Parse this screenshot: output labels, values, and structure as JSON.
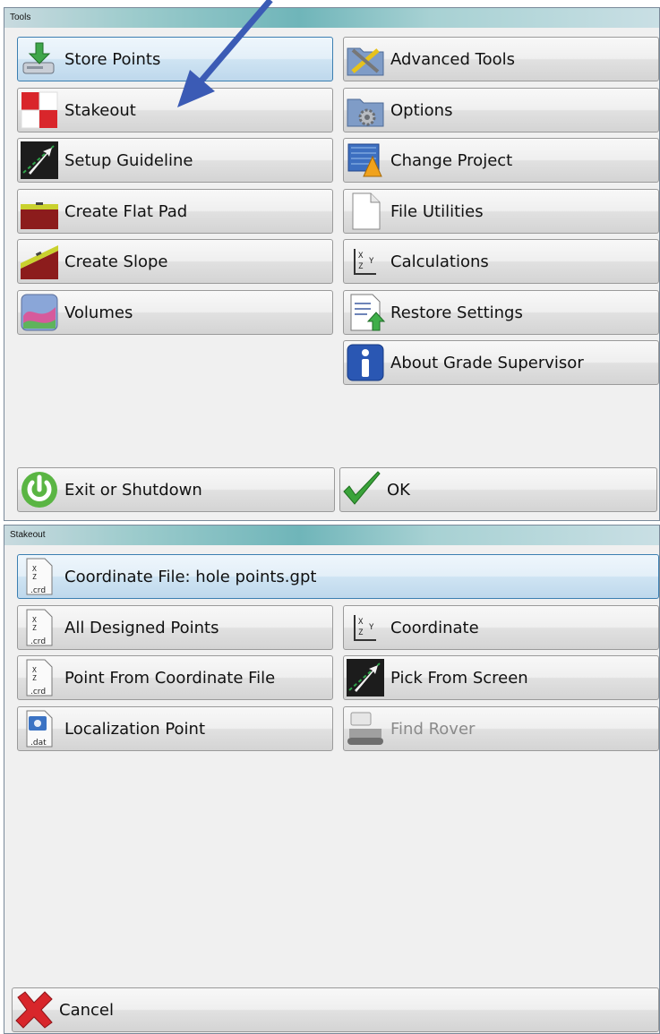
{
  "tools": {
    "title": "Tools",
    "left": [
      {
        "label": "Store Points",
        "icon": "store-points-icon"
      },
      {
        "label": "Stakeout",
        "icon": "stakeout-icon"
      },
      {
        "label": "Setup Guideline",
        "icon": "guideline-icon"
      },
      {
        "label": "Create Flat Pad",
        "icon": "flat-pad-icon"
      },
      {
        "label": "Create Slope",
        "icon": "slope-icon"
      },
      {
        "label": "Volumes",
        "icon": "volumes-icon"
      }
    ],
    "right": [
      {
        "label": "Advanced Tools",
        "icon": "advanced-tools-icon"
      },
      {
        "label": "Options",
        "icon": "options-gears-icon"
      },
      {
        "label": "Change Project",
        "icon": "change-project-icon"
      },
      {
        "label": "File Utilities",
        "icon": "file-icon"
      },
      {
        "label": "Calculations",
        "icon": "xyz-icon"
      },
      {
        "label": "Restore Settings",
        "icon": "restore-settings-icon"
      },
      {
        "label": "About Grade Supervisor",
        "icon": "info-icon"
      }
    ],
    "exit_label": "Exit or Shutdown",
    "ok_label": "OK"
  },
  "stakeout": {
    "title": "Stakeout",
    "coordinate_file_label": "Coordinate File: hole points.gpt",
    "left": [
      {
        "label": "All Designed Points",
        "icon": "crd-file-icon"
      },
      {
        "label": "Point From Coordinate File",
        "icon": "crd-file-icon"
      },
      {
        "label": "Localization Point",
        "icon": "dat-file-icon"
      }
    ],
    "right": [
      {
        "label": "Coordinate",
        "icon": "xyz-icon"
      },
      {
        "label": "Pick From Screen",
        "icon": "pick-screen-icon"
      },
      {
        "label": "Find Rover",
        "icon": "rover-icon",
        "disabled": true
      }
    ],
    "cancel_label": "Cancel"
  },
  "colors": {
    "annotation_arrow": "#3b5bb5",
    "ok_check": "#3aa33a",
    "cancel_x": "#d8262b"
  }
}
